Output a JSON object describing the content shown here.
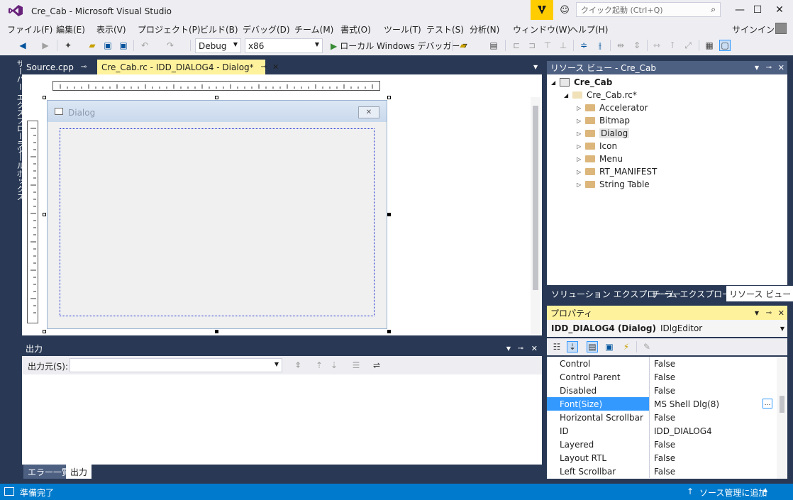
{
  "window": {
    "title": "Cre_Cab - Microsoft Visual Studio",
    "quick_launch_placeholder": "クイック起動 (Ctrl+Q)"
  },
  "menu": [
    "ファイル(F)",
    "編集(E)",
    "表示(V)",
    "プロジェクト(P)",
    "ビルド(B)",
    "デバッグ(D)",
    "チーム(M)",
    "書式(O)",
    "ツール(T)",
    "テスト(S)",
    "分析(N)",
    "ウィンドウ(W)",
    "ヘルプ(H)"
  ],
  "signin": "サインイン",
  "toolbar": {
    "config": "Debug",
    "platform": "x86",
    "run_label": "ローカル Windows デバッガー"
  },
  "side_tabs": [
    "サーバー エクスプローラー",
    "ツールボックス"
  ],
  "doc_tabs": [
    {
      "label": "Source.cpp"
    },
    {
      "label": "Cre_Cab.rc - IDD_DIALOG4 - Dialog*"
    }
  ],
  "dialog": {
    "caption": "Dialog",
    "close": "✕"
  },
  "output": {
    "title": "出力",
    "source_label": "出力元(S):",
    "tabs": [
      "エラー一覧",
      "出力"
    ]
  },
  "resource_view": {
    "title": "リソース ビュー - Cre_Cab",
    "root": "Cre_Cab",
    "rc": "Cre_Cab.rc*",
    "folders": [
      "Accelerator",
      "Bitmap",
      "Dialog",
      "Icon",
      "Menu",
      "RT_MANIFEST",
      "String Table"
    ],
    "bottom_tabs": [
      "ソリューション エクスプローラー",
      "チーム エクスプローラー",
      "リソース ビュー"
    ]
  },
  "properties": {
    "title": "プロパティ",
    "object": "IDD_DIALOG4 (Dialog)",
    "object_type": "IDlgEditor",
    "rows": [
      {
        "name": "Control",
        "value": "False"
      },
      {
        "name": "Control Parent",
        "value": "False"
      },
      {
        "name": "Disabled",
        "value": "False"
      },
      {
        "name": "Font(Size)",
        "value": "MS Shell Dlg(8)"
      },
      {
        "name": "Horizontal Scrollbar",
        "value": "False"
      },
      {
        "name": "ID",
        "value": "IDD_DIALOG4"
      },
      {
        "name": "Layered",
        "value": "False"
      },
      {
        "name": "Layout RTL",
        "value": "False"
      },
      {
        "name": "Left Scrollbar",
        "value": "False"
      }
    ]
  },
  "status": {
    "ready": "準備完了",
    "source_control": "ソース管理に追加"
  },
  "colors": {
    "accent": "#007ACC",
    "frame": "#293955",
    "selected": "#3399FF",
    "active_tab": "#FFF29D"
  }
}
